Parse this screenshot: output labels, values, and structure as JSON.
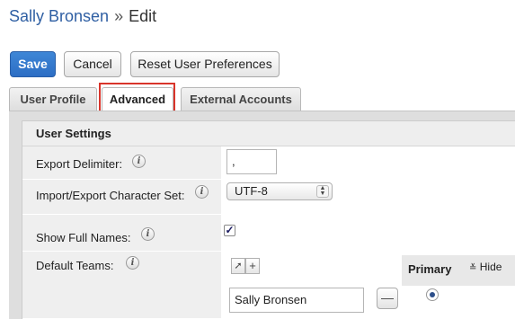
{
  "header": {
    "record_name": "Sally Bronsen",
    "separator": "»",
    "action": "Edit"
  },
  "toolbar": {
    "save_label": "Save",
    "cancel_label": "Cancel",
    "reset_label": "Reset User Preferences"
  },
  "tabs": [
    {
      "label": "User Profile",
      "active": false
    },
    {
      "label": "Advanced",
      "active": true
    },
    {
      "label": "External Accounts",
      "active": false
    }
  ],
  "user_settings": {
    "section_title": "User Settings",
    "export_delimiter": {
      "label": "Export Delimiter:",
      "value": ","
    },
    "charset": {
      "label": "Import/Export Character Set:",
      "value": "UTF-8"
    },
    "show_full_names": {
      "label": "Show Full Names:",
      "checked": true
    },
    "default_teams": {
      "label": "Default Teams:",
      "primary_header": "Primary",
      "hide_label": "Hide",
      "team_name": "Sally Bronsen"
    }
  },
  "icons": {
    "info": "i",
    "checkmark": "✓",
    "remove": "—",
    "add": "+",
    "select_arrows": "▲▼",
    "collapse": "≚"
  },
  "colors": {
    "accent": "#2f5fa3",
    "primary_button": "#3e86d6",
    "highlight": "#d9352b"
  }
}
